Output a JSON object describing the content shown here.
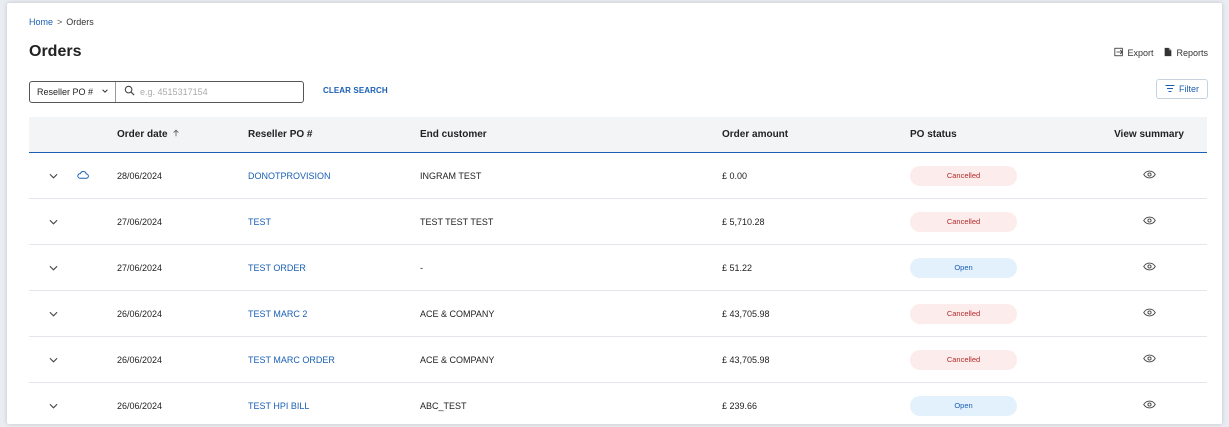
{
  "breadcrumb": {
    "home": "Home",
    "separator": ">",
    "current": "Orders"
  },
  "page": {
    "title": "Orders"
  },
  "actions": {
    "export_label": "Export",
    "reports_label": "Reports",
    "filter_label": "Filter"
  },
  "search": {
    "field_label": "Reseller PO #",
    "placeholder": "e.g. 4515317154",
    "value": "",
    "clear_label": "CLEAR SEARCH"
  },
  "table": {
    "columns": {
      "order_date": "Order date",
      "reseller_po": "Reseller PO #",
      "end_customer": "End customer",
      "order_amount": "Order amount",
      "po_status": "PO status",
      "view_summary": "View summary"
    },
    "rows": [
      {
        "cloud": true,
        "date": "28/06/2024",
        "po": "DONOTPROVISION",
        "customer": "INGRAM TEST",
        "amount": "£ 0.00",
        "status": "Cancelled"
      },
      {
        "cloud": false,
        "date": "27/06/2024",
        "po": "TEST",
        "customer": "TEST TEST TEST",
        "amount": "£ 5,710.28",
        "status": "Cancelled"
      },
      {
        "cloud": false,
        "date": "27/06/2024",
        "po": "TEST ORDER",
        "customer": "-",
        "amount": "£ 51.22",
        "status": "Open"
      },
      {
        "cloud": false,
        "date": "26/06/2024",
        "po": "TEST MARC 2",
        "customer": "ACE & COMPANY",
        "amount": "£ 43,705.98",
        "status": "Cancelled"
      },
      {
        "cloud": false,
        "date": "26/06/2024",
        "po": "TEST MARC ORDER",
        "customer": "ACE & COMPANY",
        "amount": "£ 43,705.98",
        "status": "Cancelled"
      },
      {
        "cloud": false,
        "date": "26/06/2024",
        "po": "TEST HPI BILL",
        "customer": "ABC_TEST",
        "amount": "£ 239.66",
        "status": "Open"
      }
    ]
  },
  "colors": {
    "accent": "#1a5fb4",
    "cancelled_bg": "#fdecec",
    "cancelled_text": "#b22a2a",
    "open_bg": "#e3f1fd"
  }
}
